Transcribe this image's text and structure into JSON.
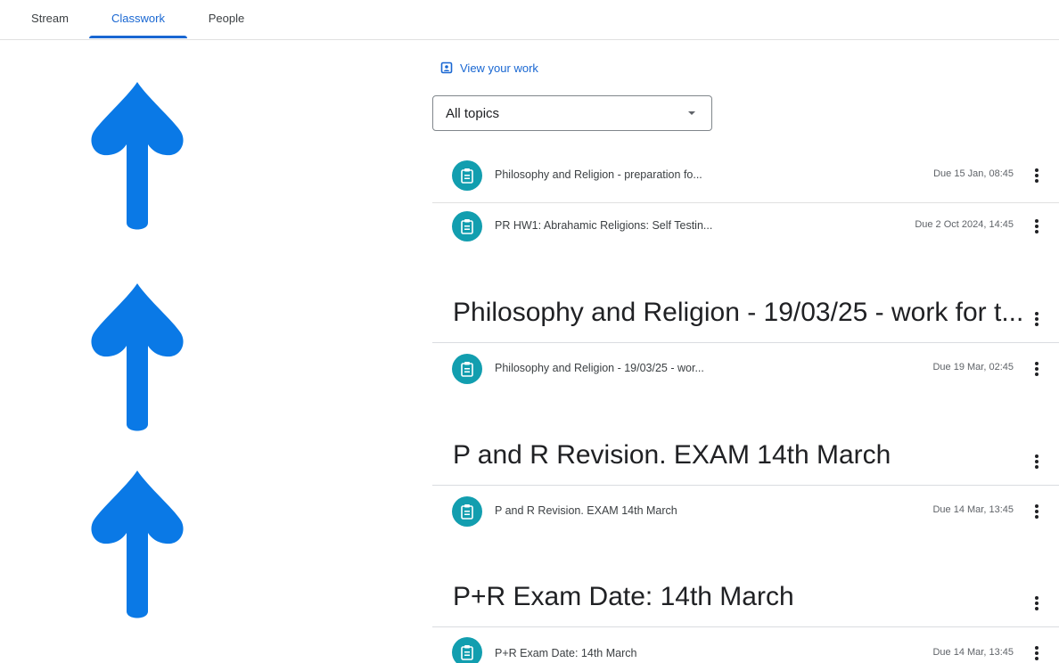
{
  "tabs": [
    {
      "label": "Stream"
    },
    {
      "label": "Classwork",
      "active": true
    },
    {
      "label": "People"
    }
  ],
  "accent_color": "#1967d2",
  "assignment_icon_color": "#129eaf",
  "arrow_color": "#0a79e6",
  "view_work": {
    "label": "View your work",
    "icon": "assignment-ind-icon"
  },
  "topic_filter": {
    "value": "All topics"
  },
  "top_items": [
    {
      "title": "Philosophy and Religion - preparation fo...",
      "due": "Due 15 Jan, 08:45"
    },
    {
      "title": "PR HW1: Abrahamic Religions: Self Testin...",
      "due": "Due 2 Oct 2024, 14:45"
    }
  ],
  "topics": [
    {
      "title": "Philosophy and Religion - 19/03/25 - work for t...",
      "items": [
        {
          "title": "Philosophy and Religion - 19/03/25 - wor...",
          "due": "Due 19 Mar, 02:45"
        }
      ]
    },
    {
      "title": "P and R Revision. EXAM 14th March",
      "items": [
        {
          "title": "P and R Revision. EXAM 14th March",
          "due": "Due 14 Mar, 13:45"
        }
      ]
    },
    {
      "title": "P+R Exam Date: 14th March",
      "items": [
        {
          "title": "P+R Exam Date: 14th March",
          "due": "Due 14 Mar, 13:45"
        }
      ]
    }
  ]
}
